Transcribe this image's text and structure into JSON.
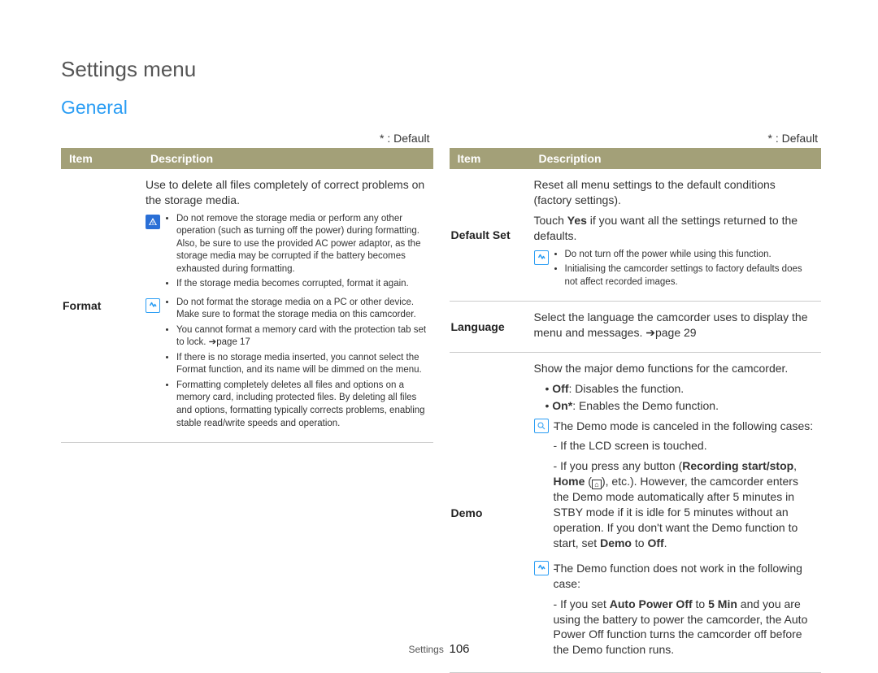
{
  "page_title": "Settings menu",
  "section_title": "General",
  "default_note": "* : Default",
  "header": {
    "item": "Item",
    "desc": "Description"
  },
  "footer": {
    "label": "Settings",
    "num": "106"
  },
  "left": {
    "format": {
      "name": "Format",
      "intro": "Use to delete all files completely of correct problems on the storage media.",
      "warn": [
        "Do not remove the storage media or perform any other operation (such as turning off the power) during formatting. Also, be sure to use the provided AC power adaptor, as the storage media may be corrupted if the battery becomes exhausted during formatting.",
        "If the storage media becomes corrupted, format it again."
      ],
      "info": [
        "Do not format the storage media on a PC or other device. Make sure to format the storage media on this camcorder.",
        "You cannot format a memory card with the protection tab set to lock. ➔page 17",
        "If there is no storage media inserted, you cannot select the Format function, and its name will be dimmed on the menu.",
        "Formatting completely deletes all files and options on a memory card, including protected files. By deleting all files and options, formatting typically corrects problems, enabling stable read/write speeds and operation."
      ]
    }
  },
  "right": {
    "defaultset": {
      "name": "Default Set",
      "intro1": "Reset all menu settings to the default conditions (factory settings).",
      "intro2_a": "Touch ",
      "intro2_b": "Yes",
      "intro2_c": " if you want all the settings returned to the defaults.",
      "info": [
        "Do not turn off the power while using this function.",
        "Initialising the camcorder settings to factory defaults does not affect recorded images."
      ]
    },
    "language": {
      "name": "Language",
      "text_a": "Select the language the camcorder uses to display the menu and messages. ",
      "text_b": "➔page 29"
    },
    "demo": {
      "name": "Demo",
      "intro": "Show the major demo functions for the camcorder.",
      "off_label": "Off",
      "off_text": ": Disables the function.",
      "on_label": "On*",
      "on_text": ": Enables the Demo function.",
      "tip_head": "The Demo mode is canceled in the following cases:",
      "tip_sub1": "If the LCD screen is touched.",
      "tip_sub2_a": "If you press any button (",
      "tip_sub2_b": "Recording start/stop",
      "tip_sub2_c": ", ",
      "tip_sub2_d": "Home",
      "tip_sub2_e": " (",
      "tip_sub2_f": "), etc.). However, the camcorder enters the Demo mode automatically after 5 minutes in STBY mode if it is idle for 5 minutes without an operation. If you don't want the Demo function to start, set ",
      "tip_sub2_g": "Demo",
      "tip_sub2_h": " to ",
      "tip_sub2_i": "Off",
      "tip_sub2_j": ".",
      "info_head": "The Demo function does not work in the following case:",
      "info_sub_a": "If you set ",
      "info_sub_b": "Auto Power Off",
      "info_sub_c": " to ",
      "info_sub_d": "5 Min",
      "info_sub_e": " and you are using the battery to power the camcorder, the Auto Power Off function turns the camcorder off before the Demo function runs."
    }
  }
}
